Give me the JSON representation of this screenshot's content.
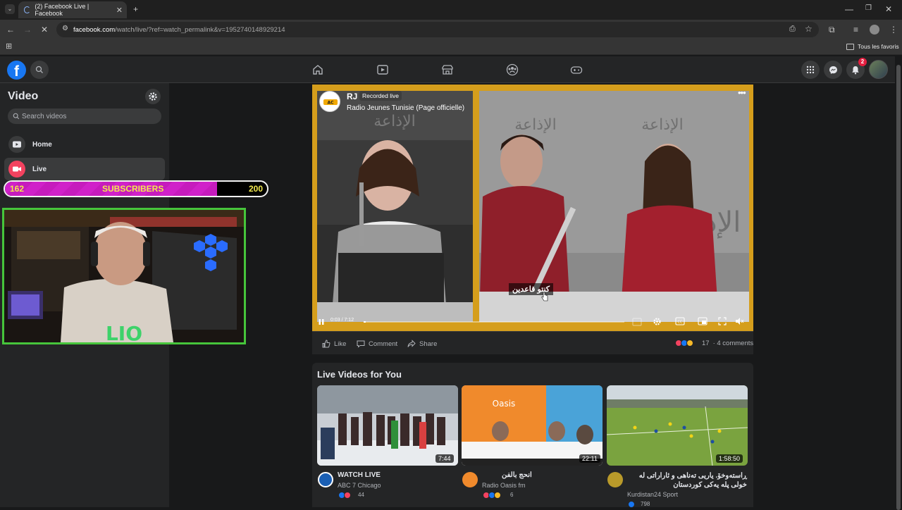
{
  "browser": {
    "tab_title": "(2) Facebook Live | Facebook",
    "url_domain": "facebook.com",
    "url_path": "/watch/live/?ref=watch_permalink&v=1952740148929214",
    "bookmarks_label": "Tous les favoris"
  },
  "header": {
    "notification_count": "2",
    "accent": "#1877f2"
  },
  "sidebar": {
    "title": "Video",
    "search_placeholder": "Search videos",
    "items": [
      {
        "label": "Home",
        "icon": "play-icon"
      },
      {
        "label": "Live",
        "icon": "live-camera-icon"
      }
    ]
  },
  "overlay": {
    "subs_current": "162",
    "subs_label": "SUBSCRIBERS",
    "subs_goal": "200",
    "subs_progress": 0.81,
    "webcam_tag": "LIO"
  },
  "player": {
    "channel_initials": "RJ",
    "status": "Recorded live",
    "page_name": "Radio Jeunes Tunisie (Page officielle)",
    "caption": "كنتو قاعدين",
    "time": "0:03 / 7:12",
    "progress": 0.007
  },
  "actions": {
    "like": "Like",
    "comment": "Comment",
    "share": "Share",
    "reaction_count": "17",
    "comments": "· 4 comments"
  },
  "live_section": {
    "title": "Live Videos for You",
    "cards": [
      {
        "title": "WATCH LIVE",
        "channel": "ABC 7 Chicago",
        "count": "44",
        "duration": "7:44"
      },
      {
        "title": "انحج بالفن",
        "channel": "Radio Oasis fm",
        "count": "6",
        "duration": "22:11"
      },
      {
        "title": "ڕاستەوخۆ. یاریی تەناهی و ئاراراتی لە خولی پلە یەکی کوردستان",
        "channel": "Kurdistan24 Sport",
        "count": "798",
        "duration": "1:58:50"
      }
    ]
  }
}
